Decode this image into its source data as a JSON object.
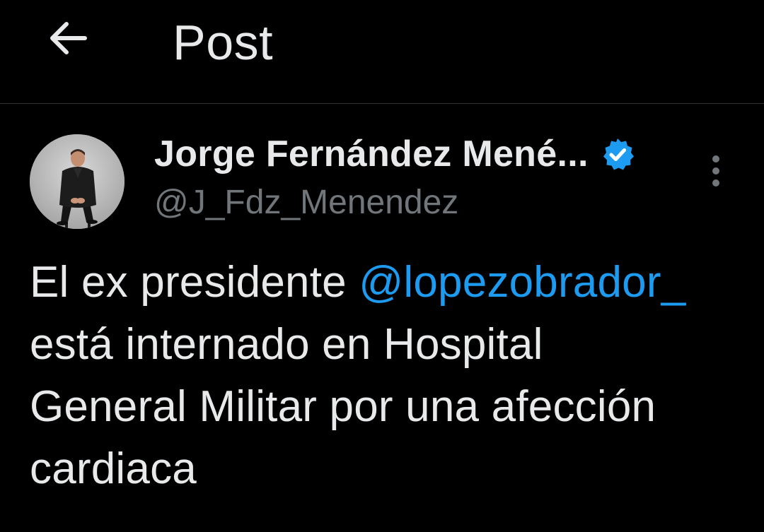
{
  "header": {
    "title": "Post",
    "back_icon": "arrow-left-icon"
  },
  "author": {
    "display_name": "Jorge Fernández Mené...",
    "handle": "@J_Fdz_Menendez",
    "verified_icon": "verified-badge-icon",
    "verified_color": "#1d9bf0"
  },
  "post": {
    "text_line1_prefix": "El ex presidente ",
    "mention": "@lopezobrador_",
    "text_line2": "está internado en Hospital",
    "text_line3": "General Militar por una afección",
    "text_line4": "cardiaca"
  },
  "more_icon": "more-vertical-icon",
  "colors": {
    "background": "#000000",
    "text": "#e7e9ea",
    "secondary": "#71767b",
    "link": "#1d9bf0",
    "divider": "#2f3336"
  }
}
